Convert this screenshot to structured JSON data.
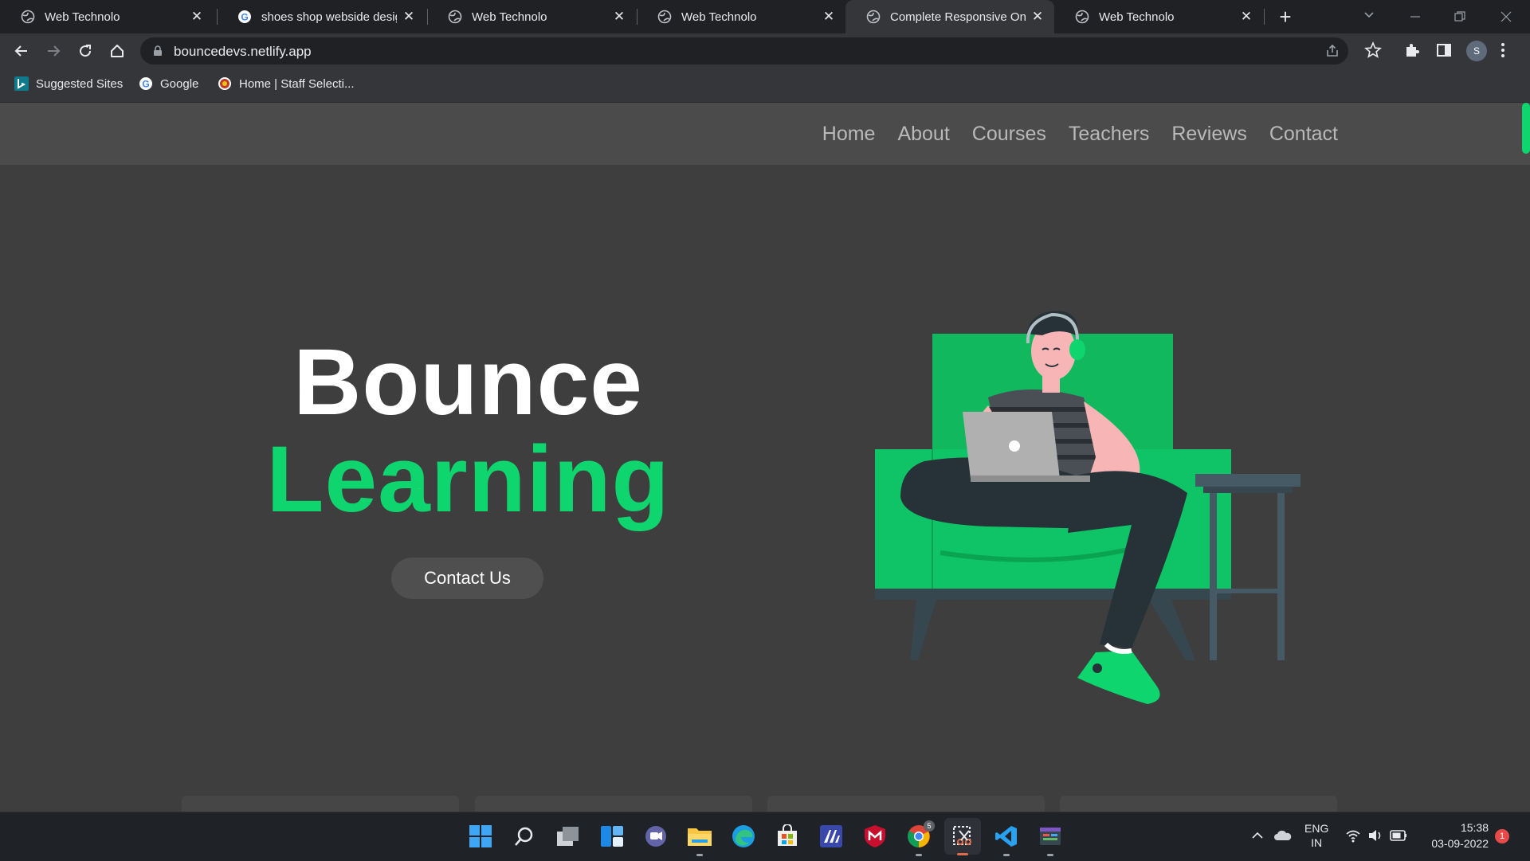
{
  "browser": {
    "tabs": [
      {
        "title": "Web Technolo",
        "active": false
      },
      {
        "title": "shoes shop webside design",
        "active": false
      },
      {
        "title": "Web Technolo",
        "active": false
      },
      {
        "title": "Web Technolo",
        "active": false
      },
      {
        "title": "Complete Responsive Online",
        "active": true
      },
      {
        "title": "Web Technolo",
        "active": false
      }
    ],
    "close_glyph": "✕",
    "new_tab_glyph": "+",
    "url": "bouncedevs.netlify.app",
    "profile_initial": "S",
    "bookmarks": [
      {
        "label": "Suggested Sites",
        "icon": "bing-icon"
      },
      {
        "label": "Google",
        "icon": "google-icon"
      },
      {
        "label": "Home | Staff Selecti...",
        "icon": "ssc-emblem-icon"
      }
    ]
  },
  "site": {
    "nav": [
      "Home",
      "About",
      "Courses",
      "Teachers",
      "Reviews",
      "Contact"
    ],
    "hero": {
      "title_line1": "Bounce",
      "title_line2": "Learning",
      "cta": "Contact Us"
    },
    "accent_color": "#0fd56e"
  },
  "taskbar": {
    "apps": [
      "windows-start-icon",
      "search-icon",
      "task-view-icon",
      "widgets-icon",
      "teams-chat-icon",
      "file-explorer-icon",
      "edge-icon",
      "store-icon",
      "app-icon",
      "mcafee-icon",
      "chrome-icon",
      "snipping-tool-icon",
      "vscode-icon",
      "app-icon"
    ],
    "chrome_badge": "5",
    "language_line1": "ENG",
    "language_line2": "IN",
    "time": "15:38",
    "date": "03-09-2022",
    "notification_count": "1"
  }
}
